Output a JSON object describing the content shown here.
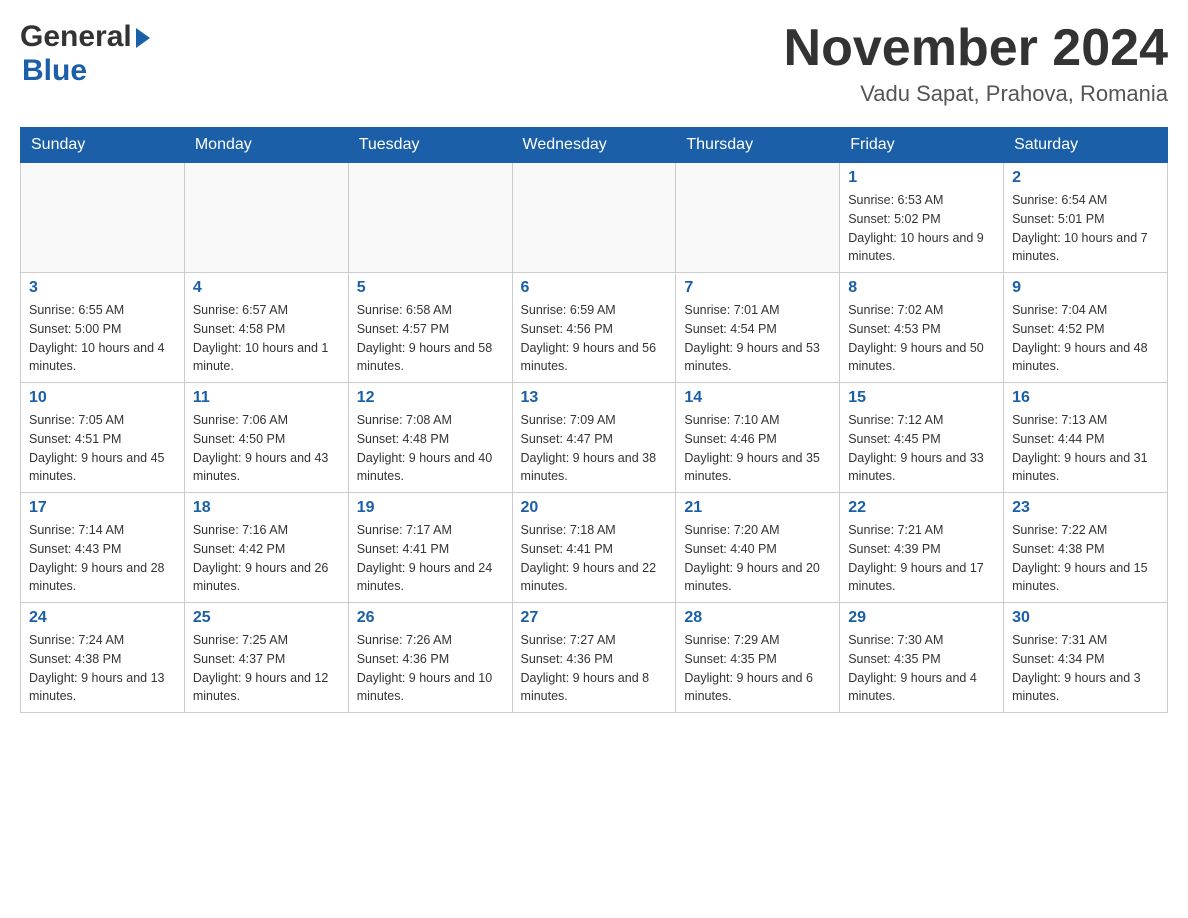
{
  "header": {
    "logo_general": "General",
    "logo_blue": "Blue",
    "month_title": "November 2024",
    "location": "Vadu Sapat, Prahova, Romania"
  },
  "days_of_week": [
    "Sunday",
    "Monday",
    "Tuesday",
    "Wednesday",
    "Thursday",
    "Friday",
    "Saturday"
  ],
  "weeks": [
    [
      {
        "day": "",
        "info": ""
      },
      {
        "day": "",
        "info": ""
      },
      {
        "day": "",
        "info": ""
      },
      {
        "day": "",
        "info": ""
      },
      {
        "day": "",
        "info": ""
      },
      {
        "day": "1",
        "info": "Sunrise: 6:53 AM\nSunset: 5:02 PM\nDaylight: 10 hours and 9 minutes."
      },
      {
        "day": "2",
        "info": "Sunrise: 6:54 AM\nSunset: 5:01 PM\nDaylight: 10 hours and 7 minutes."
      }
    ],
    [
      {
        "day": "3",
        "info": "Sunrise: 6:55 AM\nSunset: 5:00 PM\nDaylight: 10 hours and 4 minutes."
      },
      {
        "day": "4",
        "info": "Sunrise: 6:57 AM\nSunset: 4:58 PM\nDaylight: 10 hours and 1 minute."
      },
      {
        "day": "5",
        "info": "Sunrise: 6:58 AM\nSunset: 4:57 PM\nDaylight: 9 hours and 58 minutes."
      },
      {
        "day": "6",
        "info": "Sunrise: 6:59 AM\nSunset: 4:56 PM\nDaylight: 9 hours and 56 minutes."
      },
      {
        "day": "7",
        "info": "Sunrise: 7:01 AM\nSunset: 4:54 PM\nDaylight: 9 hours and 53 minutes."
      },
      {
        "day": "8",
        "info": "Sunrise: 7:02 AM\nSunset: 4:53 PM\nDaylight: 9 hours and 50 minutes."
      },
      {
        "day": "9",
        "info": "Sunrise: 7:04 AM\nSunset: 4:52 PM\nDaylight: 9 hours and 48 minutes."
      }
    ],
    [
      {
        "day": "10",
        "info": "Sunrise: 7:05 AM\nSunset: 4:51 PM\nDaylight: 9 hours and 45 minutes."
      },
      {
        "day": "11",
        "info": "Sunrise: 7:06 AM\nSunset: 4:50 PM\nDaylight: 9 hours and 43 minutes."
      },
      {
        "day": "12",
        "info": "Sunrise: 7:08 AM\nSunset: 4:48 PM\nDaylight: 9 hours and 40 minutes."
      },
      {
        "day": "13",
        "info": "Sunrise: 7:09 AM\nSunset: 4:47 PM\nDaylight: 9 hours and 38 minutes."
      },
      {
        "day": "14",
        "info": "Sunrise: 7:10 AM\nSunset: 4:46 PM\nDaylight: 9 hours and 35 minutes."
      },
      {
        "day": "15",
        "info": "Sunrise: 7:12 AM\nSunset: 4:45 PM\nDaylight: 9 hours and 33 minutes."
      },
      {
        "day": "16",
        "info": "Sunrise: 7:13 AM\nSunset: 4:44 PM\nDaylight: 9 hours and 31 minutes."
      }
    ],
    [
      {
        "day": "17",
        "info": "Sunrise: 7:14 AM\nSunset: 4:43 PM\nDaylight: 9 hours and 28 minutes."
      },
      {
        "day": "18",
        "info": "Sunrise: 7:16 AM\nSunset: 4:42 PM\nDaylight: 9 hours and 26 minutes."
      },
      {
        "day": "19",
        "info": "Sunrise: 7:17 AM\nSunset: 4:41 PM\nDaylight: 9 hours and 24 minutes."
      },
      {
        "day": "20",
        "info": "Sunrise: 7:18 AM\nSunset: 4:41 PM\nDaylight: 9 hours and 22 minutes."
      },
      {
        "day": "21",
        "info": "Sunrise: 7:20 AM\nSunset: 4:40 PM\nDaylight: 9 hours and 20 minutes."
      },
      {
        "day": "22",
        "info": "Sunrise: 7:21 AM\nSunset: 4:39 PM\nDaylight: 9 hours and 17 minutes."
      },
      {
        "day": "23",
        "info": "Sunrise: 7:22 AM\nSunset: 4:38 PM\nDaylight: 9 hours and 15 minutes."
      }
    ],
    [
      {
        "day": "24",
        "info": "Sunrise: 7:24 AM\nSunset: 4:38 PM\nDaylight: 9 hours and 13 minutes."
      },
      {
        "day": "25",
        "info": "Sunrise: 7:25 AM\nSunset: 4:37 PM\nDaylight: 9 hours and 12 minutes."
      },
      {
        "day": "26",
        "info": "Sunrise: 7:26 AM\nSunset: 4:36 PM\nDaylight: 9 hours and 10 minutes."
      },
      {
        "day": "27",
        "info": "Sunrise: 7:27 AM\nSunset: 4:36 PM\nDaylight: 9 hours and 8 minutes."
      },
      {
        "day": "28",
        "info": "Sunrise: 7:29 AM\nSunset: 4:35 PM\nDaylight: 9 hours and 6 minutes."
      },
      {
        "day": "29",
        "info": "Sunrise: 7:30 AM\nSunset: 4:35 PM\nDaylight: 9 hours and 4 minutes."
      },
      {
        "day": "30",
        "info": "Sunrise: 7:31 AM\nSunset: 4:34 PM\nDaylight: 9 hours and 3 minutes."
      }
    ]
  ]
}
